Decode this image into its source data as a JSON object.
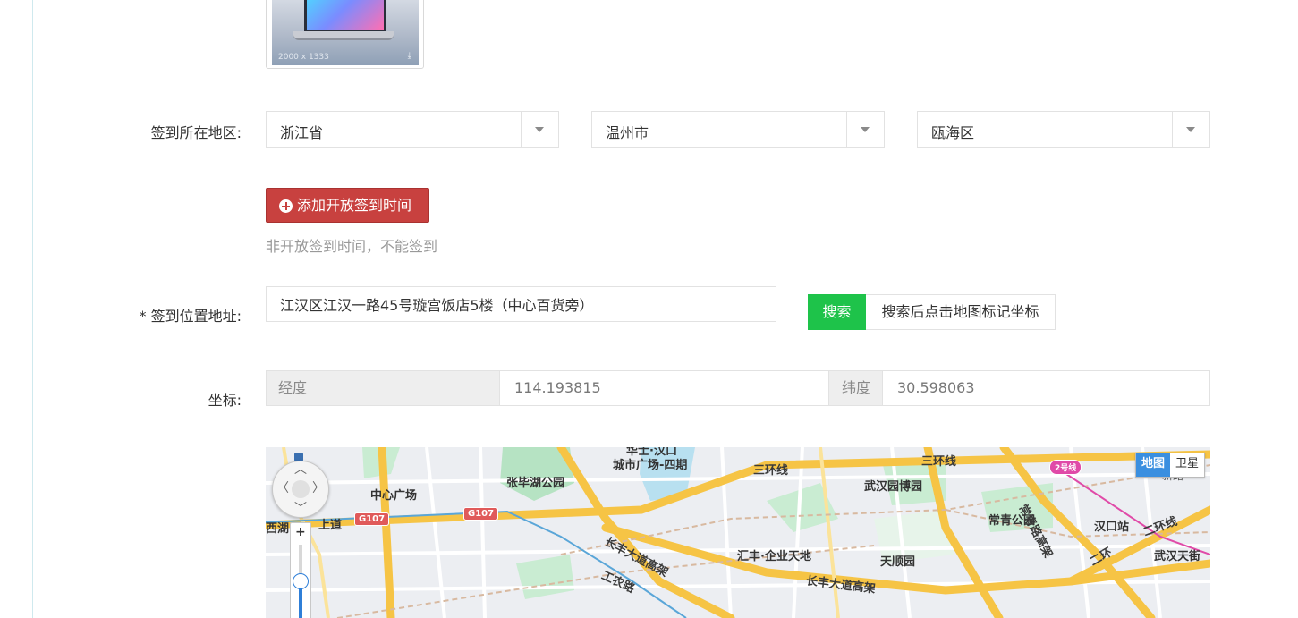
{
  "thumbnail": {
    "dimension_text": "2000 x 1333"
  },
  "region": {
    "label": "签到所在地区:",
    "province": "浙江省",
    "city": "温州市",
    "district": "瓯海区"
  },
  "open_time": {
    "button_label": "添加开放签到时间",
    "hint": "非开放签到时间，不能签到"
  },
  "address": {
    "label": "* 签到位置地址:",
    "value": "江汉区江汉一路45号璇宫饭店5楼（中心百货旁）",
    "search_button": "搜索",
    "search_tip": "搜索后点击地图标记坐标"
  },
  "coords": {
    "label": "坐标:",
    "lng_label": "经度",
    "lng_value": "114.193815",
    "lat_label": "纬度",
    "lat_value": "30.598063"
  },
  "map": {
    "type_map": "地图",
    "type_satellite": "卫星",
    "zoom_level_fraction": 0.6,
    "labels": {
      "center_square": "中心广场",
      "zhanghua_park": "张毕湖公园",
      "city_square": "城市广场-四期",
      "third_ring_1": "三环线",
      "third_ring_2": "三环线",
      "wuhan_expo": "武汉园博园",
      "changqing_park": "常青公园",
      "changqing_road": "常青路高架",
      "hankou_station": "汉口站",
      "second_ring": "二环线",
      "wuhan_tianjie": "武汉天街",
      "huifeng": "汇丰·企业天地",
      "tianshun": "天顺园",
      "changfeng_1": "长丰大道高架",
      "changfeng_2": "长丰大道高架",
      "gongnong": "工农路",
      "xihu": "西湖",
      "shangdao": "上道",
      "metro_line": "2号线",
      "g107_a": "G107",
      "g107_b": "G107",
      "xinlu": "新路",
      "erhuan_cut": "二环",
      "top_cut": "华士·汉口"
    }
  },
  "colors": {
    "add_button": "#c8413f",
    "search_button": "#1ec34a",
    "map_type_active": "#3a8fe0"
  }
}
